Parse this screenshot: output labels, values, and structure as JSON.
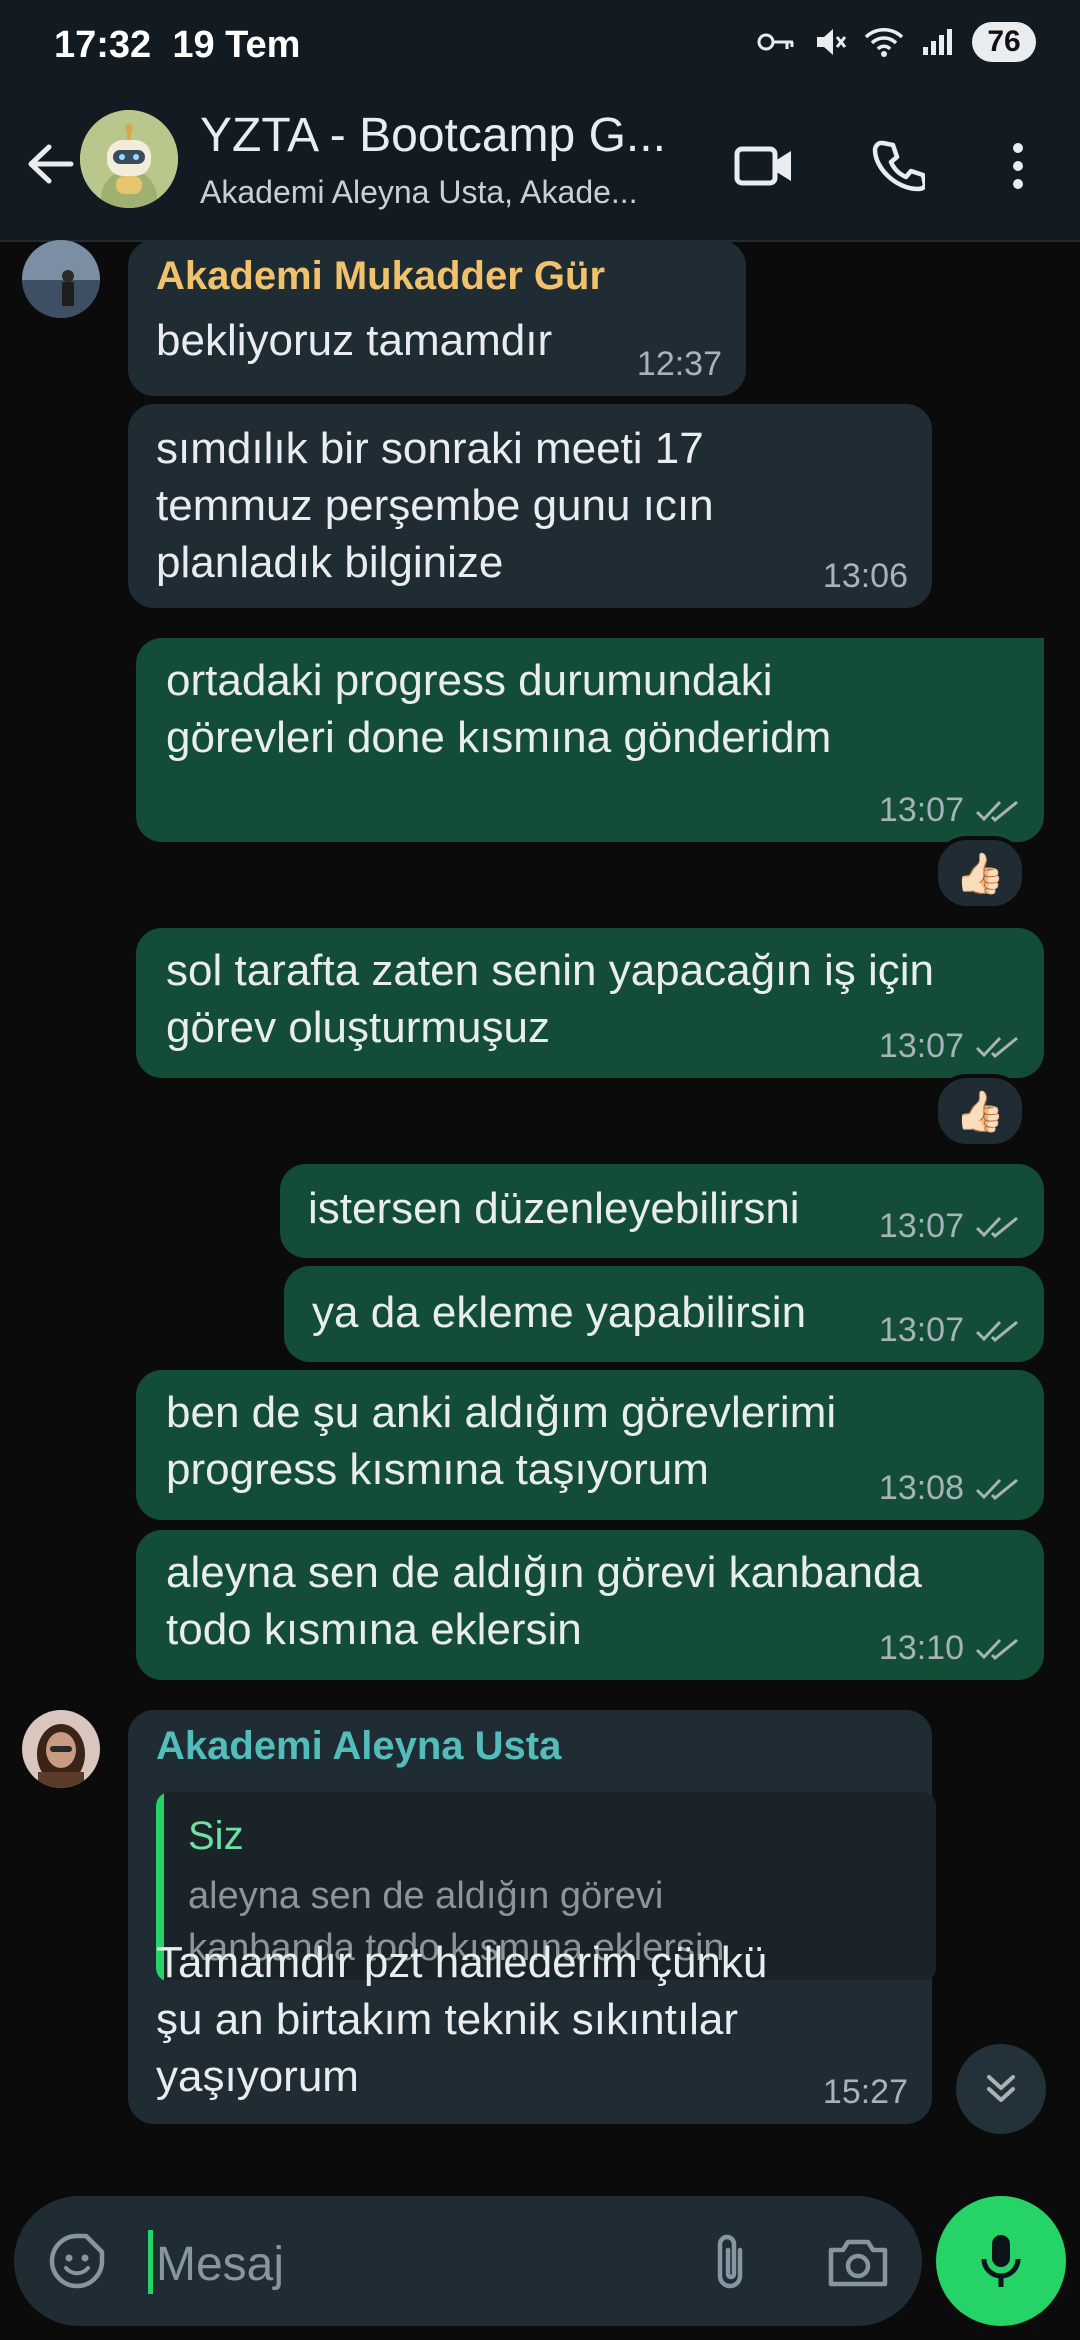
{
  "status_bar": {
    "time": "17:32",
    "date": "19 Tem",
    "battery": "76"
  },
  "header": {
    "title": "YZTA - Bootcamp G...",
    "subtitle": "Akademi Aleyna Usta, Akade..."
  },
  "messages": [
    {
      "sender": "Akademi Mukadder Gür",
      "text": "bekliyoruz tamamdır",
      "time": "12:37"
    },
    {
      "text": "sımdılık bir sonraki meeti 17\ntemmuz perşembe gunu ıcın\nplanladık bilginize",
      "time": "13:06"
    },
    {
      "text": "ortadaki progress durumundaki\ngörevleri done kısmına gönderidm",
      "time": "13:07",
      "reaction": "👍🏻"
    },
    {
      "text": "sol tarafta zaten senin yapacağın iş için\ngörev oluşturmuşuz",
      "time": "13:07",
      "reaction": "👍🏻"
    },
    {
      "text": "istersen düzenleyebilirsni",
      "time": "13:07"
    },
    {
      "text": "ya da ekleme yapabilirsin",
      "time": "13:07"
    },
    {
      "text": "ben de şu anki aldığım görevlerimi\nprogress kısmına taşıyorum",
      "time": "13:08"
    },
    {
      "text": "aleyna sen de aldığın görevi kanbanda\ntodo kısmına eklersin",
      "time": "13:10"
    },
    {
      "sender": "Akademi Aleyna Usta",
      "quote_author": "Siz",
      "quote_text": "aleyna sen de aldığın görevi\nkanbanda todo kısmına eklersin",
      "text": "Tamamdır pzt hallederim çünkü\nşu an birtakım teknik sıkıntılar\nyaşıyorum",
      "time": "15:27"
    }
  ],
  "input": {
    "placeholder": "Mesaj"
  },
  "colors": {
    "background": "#0b0b0b",
    "header": "#111b21",
    "incoming_bubble": "#202c33",
    "outgoing_bubble": "#134d37",
    "accent_green": "#25d366",
    "sender_mukadder": "#f0c26b",
    "sender_aleyna": "#53bdbb",
    "read_ticks": "#a6b3b9"
  }
}
